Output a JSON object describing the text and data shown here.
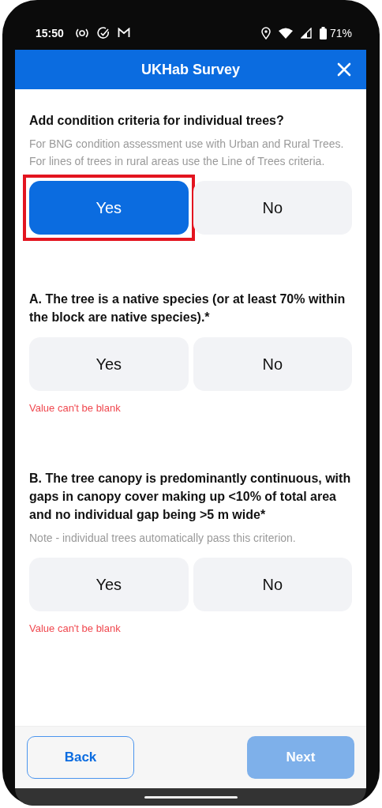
{
  "status_bar": {
    "time": "15:50",
    "battery": "71%"
  },
  "app_bar": {
    "title": "UKHab Survey"
  },
  "questions": [
    {
      "title": "Add condition criteria for individual trees?",
      "hint": "For BNG condition assessment use with Urban and Rural Trees. For lines of trees in rural areas use the Line of Trees criteria.",
      "options": [
        {
          "label": "Yes",
          "selected": true,
          "highlighted": true
        },
        {
          "label": "No",
          "selected": false,
          "highlighted": false
        }
      ]
    },
    {
      "title": "A. The tree is a native species (or at least 70% within the block are native species).*",
      "options": [
        {
          "label": "Yes",
          "selected": false,
          "highlighted": false
        },
        {
          "label": "No",
          "selected": false,
          "highlighted": false
        }
      ],
      "error": "Value can't be blank"
    },
    {
      "title": "B. The tree canopy is predominantly continuous, with gaps in canopy cover making up <10% of total area and no individual gap being >5 m wide*",
      "hint": "Note - individual trees automatically pass this criterion.",
      "options": [
        {
          "label": "Yes",
          "selected": false,
          "highlighted": false
        },
        {
          "label": "No",
          "selected": false,
          "highlighted": false
        }
      ],
      "error": "Value can't be blank"
    }
  ],
  "footer": {
    "back": {
      "label": "Back",
      "disabled": false
    },
    "next": {
      "label": "Next",
      "disabled": true
    }
  }
}
